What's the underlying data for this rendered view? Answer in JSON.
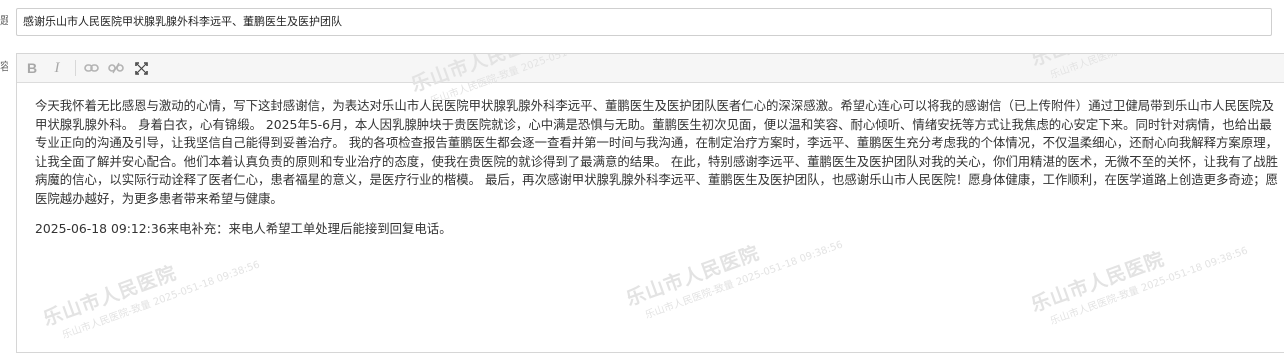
{
  "form": {
    "title_label_char": "题",
    "content_label_char": "容",
    "title_value": "感谢乐山市人民医院甲状腺乳腺外科李远平、董鹏医生及医护团队"
  },
  "toolbar": {
    "icons": [
      "bold-icon",
      "italic-icon",
      "link-icon",
      "unlink-icon",
      "fullscreen-icon"
    ],
    "bold_glyph": "B",
    "italic_glyph": "I"
  },
  "content": {
    "paragraph": "今天我怀着无比感恩与激动的心情，写下这封感谢信，为表达对乐山市人民医院甲状腺乳腺外科李远平、董鹏医生及医护团队医者仁心的深深感激。希望心连心可以将我的感谢信（已上传附件）通过卫健局带到乐山市人民医院及甲状腺乳腺外科。 身着白衣，心有锦缎。 2025年5-6月，本人因乳腺肿块于贵医院就诊，心中满是恐惧与无助。董鹏医生初次见面，便以温和笑容、耐心倾听、情绪安抚等方式让我焦虑的心安定下来。同时针对病情，也给出最专业正向的沟通及引导，让我坚信自己能得到妥善治疗。 我的各项检查报告董鹏医生都会逐一查看并第一时间与我沟通，在制定治疗方案时，李远平、董鹏医生充分考虑我的个体情况，不仅温柔细心，还耐心向我解释方案原理，让我全面了解并安心配合。他们本着认真负责的原则和专业治疗的态度，使我在贵医院的就诊得到了最满意的结果。 在此，特别感谢李远平、董鹏医生及医护团队对我的关心，你们用精湛的医术，无微不至的关怀，让我有了战胜病魔的信心，以实际行动诠释了医者仁心，患者福星的意义，是医疗行业的楷模。 最后，再次感谢甲状腺乳腺外科李远平、董鹏医生及医护团队，也感谢乐山市人民医院！愿身体健康，工作顺利，在医学道路上创造更多奇迹；愿医院越办越好，为更多患者带来希望与健康。",
    "supplement": "2025-06-18 09:12:36来电补充：来电人希望工单处理后能接到回复电话。"
  },
  "watermark": {
    "text": "乐山市人民医院",
    "subtext": "乐山市人民医院-致量 2025-051-18 09:38:56"
  }
}
